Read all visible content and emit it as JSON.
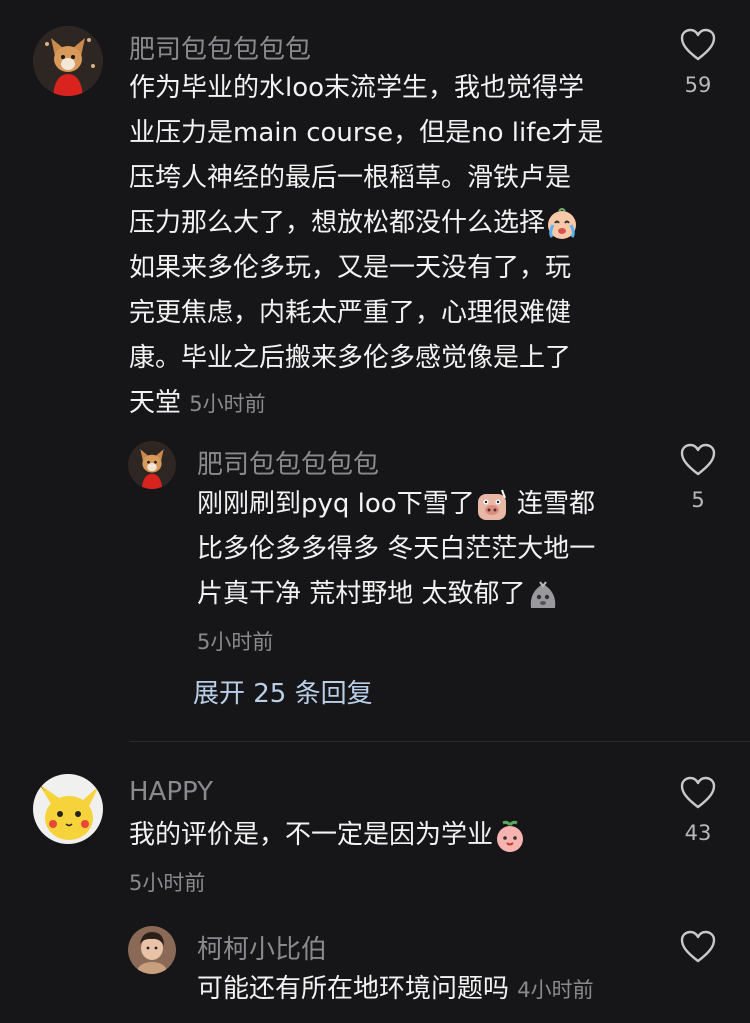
{
  "comments": [
    {
      "username": "肥司包包包包包",
      "lines": [
        "作为毕业的水loo末流学生，我也觉得学",
        "业压力是main course，但是no life才是",
        "压垮人神经的最后一根稻草。滑铁卢是",
        "压力那么大了，想放松都没什么选择",
        "如果来多伦多玩，又是一天没有了，玩",
        "完更焦虑，内耗太严重了，心理很难健",
        "康。毕业之后搬来多伦多感觉像是上了",
        "天堂"
      ],
      "time": "5小时前",
      "likes": "59"
    },
    {
      "username": "肥司包包包包包",
      "lines": [
        "刚刚刷到pyq loo下雪了",
        "连雪都",
        "比多伦多多得多 冬天白茫茫大地一",
        "片真干净 荒村野地 太致郁了"
      ],
      "time": "5小时前",
      "likes": "5"
    },
    {
      "username": "HAPPY",
      "lines": [
        "我的评价是，不一定是因为学业"
      ],
      "time": "5小时前",
      "likes": "43"
    },
    {
      "username": "柯柯小比伯",
      "lines": [
        "可能还有所在地环境问题吗"
      ],
      "time": "4小时前"
    }
  ],
  "expand_replies": "展开 25 条回复",
  "icons": {
    "like": "heart-outline-icon",
    "crying": "crying-emoji-icon",
    "pig": "pig-emoji-icon",
    "rock": "rock-emoji-icon",
    "peach": "peach-emoji-icon"
  },
  "colors": {
    "background": "#161618",
    "username": "#8a8a8e",
    "text": "#f2f2f2",
    "link": "#b9cfe8"
  }
}
